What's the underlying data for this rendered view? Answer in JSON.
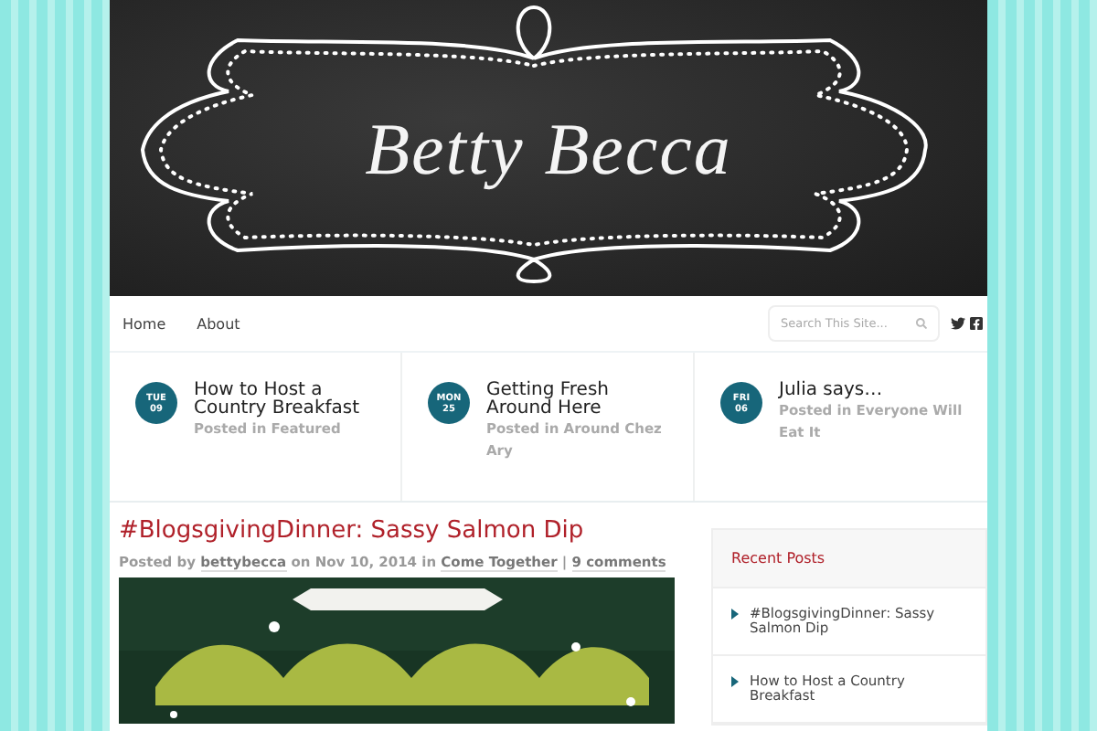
{
  "header": {
    "site_title": "Betty Becca"
  },
  "nav": {
    "items": [
      {
        "label": "Home"
      },
      {
        "label": "About"
      }
    ]
  },
  "search": {
    "placeholder": "Search This Site..."
  },
  "featured": [
    {
      "day": "TUE",
      "date": "09",
      "title": "How to Host a Country Breakfast",
      "meta": "Posted in Featured"
    },
    {
      "day": "MON",
      "date": "25",
      "title": "Getting Fresh Around Here",
      "meta": "Posted in Around Chez Ary"
    },
    {
      "day": "FRI",
      "date": "06",
      "title": "Julia says…",
      "meta": "Posted in Everyone Will Eat It"
    }
  ],
  "post": {
    "title": "#BlogsgivingDinner: Sassy Salmon Dip",
    "meta": [
      {
        "kind": "text",
        "text": "Posted by"
      },
      {
        "kind": "link",
        "text": "bettybecca"
      },
      {
        "kind": "text",
        "text": "on Nov 10, 2014 in"
      },
      {
        "kind": "link",
        "text": "Come Together"
      },
      {
        "kind": "text",
        "text": "|"
      },
      {
        "kind": "link",
        "text": "9 comments"
      }
    ]
  },
  "sidebar": {
    "widget_title": "Recent Posts",
    "items": [
      {
        "label": "#BlogsgivingDinner: Sassy Salmon Dip"
      },
      {
        "label": "How to Host a Country Breakfast"
      }
    ]
  }
}
